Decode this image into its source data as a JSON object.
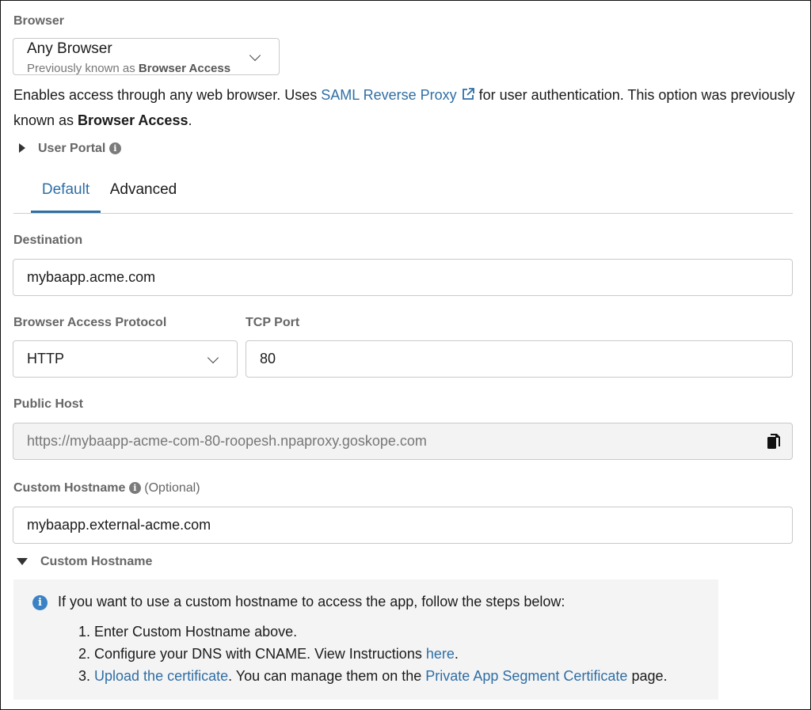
{
  "browser": {
    "label": "Browser",
    "select_value": "Any Browser",
    "select_sub_prefix": "Previously known as ",
    "select_sub_bold": "Browser Access"
  },
  "description": {
    "part1": "Enables access through any web browser. Uses ",
    "link": "SAML Reverse Proxy",
    "part2": " for user authentication. This option was previously known as ",
    "bold": "Browser Access",
    "part3": "."
  },
  "user_portal": {
    "label": "User Portal"
  },
  "tabs": [
    {
      "label": "Default",
      "active": true
    },
    {
      "label": "Advanced",
      "active": false
    }
  ],
  "destination": {
    "label": "Destination",
    "value": "mybaapp.acme.com"
  },
  "protocol": {
    "label": "Browser Access Protocol",
    "value": "HTTP"
  },
  "tcp_port": {
    "label": "TCP Port",
    "value": "80"
  },
  "public_host": {
    "label": "Public Host",
    "value": "https://mybaapp-acme-com-80-roopesh.npaproxy.goskope.com"
  },
  "custom_hostname": {
    "label": "Custom Hostname",
    "optional": "(Optional)",
    "value": "mybaapp.external-acme.com",
    "section_label": "Custom Hostname"
  },
  "info": {
    "intro": "If you want to use a custom hostname to access the app, follow the steps below:",
    "step1": "1. Enter Custom Hostname above.",
    "step2_prefix": "2. Configure your DNS with CNAME. View Instructions ",
    "step2_link": "here",
    "step2_suffix": ".",
    "step3_prefix": "3. ",
    "step3_link1": "Upload the certificate",
    "step3_middle": ". You can manage them on the ",
    "step3_link2": "Private App Segment Certificate",
    "step3_suffix": " page."
  },
  "icons": {
    "external_link": "external-link-icon",
    "info": "info-icon",
    "copy": "copy-icon",
    "chevron": "chevron-down-icon"
  },
  "colors": {
    "link": "#2f6ea5",
    "tab_active": "#2f6ea5",
    "info_icon": "#3b82c4"
  }
}
